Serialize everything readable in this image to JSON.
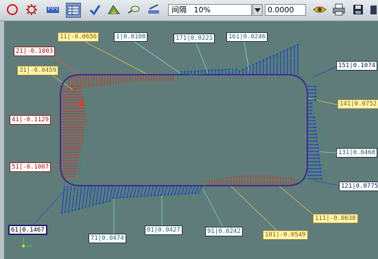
{
  "toolbar": {
    "icons": [
      "circle-icon",
      "gear-icon",
      "ruler-icon",
      "table-icon",
      "check-icon",
      "profile-icon",
      "zoom-icon",
      "edit-icon",
      "eye-icon",
      "print-icon",
      "save-icon",
      "exit-icon"
    ],
    "interval_value": "间隔   10%",
    "value_field": "0.0000"
  },
  "labels": [
    {
      "id": "l11",
      "text": "11|-0.0656",
      "style": "y"
    },
    {
      "id": "l1",
      "text": "1|0.0108",
      "style": "c"
    },
    {
      "id": "l171",
      "text": "171|0.0221",
      "style": "c"
    },
    {
      "id": "l161",
      "text": "161|0.0246",
      "style": "c"
    },
    {
      "id": "l21",
      "text": "21|-0.1003",
      "style": "r"
    },
    {
      "id": "l31",
      "text": "31|-0.0459",
      "style": "y"
    },
    {
      "id": "l151",
      "text": "151|0.1074",
      "style": "w"
    },
    {
      "id": "l141",
      "text": "141|0.0752",
      "style": "y"
    },
    {
      "id": "l41",
      "text": "41|-0.1129",
      "style": "r"
    },
    {
      "id": "l131",
      "text": "131|0.0468",
      "style": "c"
    },
    {
      "id": "l51",
      "text": "51|-0.1007",
      "style": "r"
    },
    {
      "id": "l121",
      "text": "121|0.0775",
      "style": "w"
    },
    {
      "id": "l111",
      "text": "111|-0.0638",
      "style": "y"
    },
    {
      "id": "l61",
      "text": "61|0.1467",
      "style": "bb"
    },
    {
      "id": "l71",
      "text": "71|0.0474",
      "style": "c"
    },
    {
      "id": "l81",
      "text": "81|0.0427",
      "style": "c"
    },
    {
      "id": "l91",
      "text": "91|0.0242",
      "style": "c"
    },
    {
      "id": "l101",
      "text": "101|-0.0549",
      "style": "y"
    }
  ],
  "colors": {
    "canvas": "#607c7a",
    "profile": "#3b2d8f",
    "positive": "#1f4fb8",
    "negative": "#c8342c",
    "leader": "#d9c64a"
  }
}
